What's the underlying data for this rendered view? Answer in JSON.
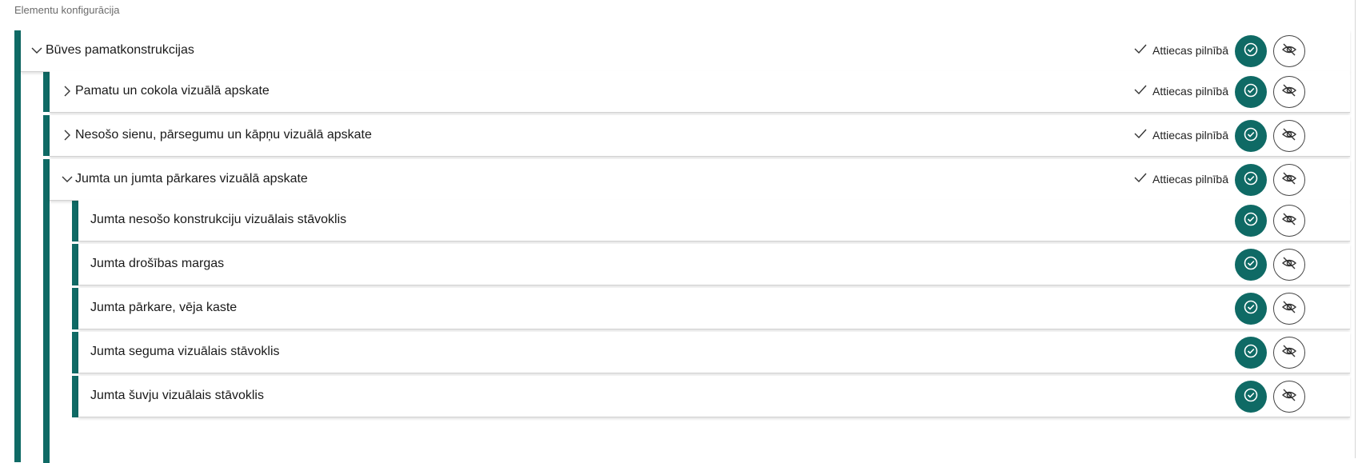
{
  "section_title": "Elementu konfigurācija",
  "status_label": "Attiecas pilnībā",
  "colors": {
    "accent": "#0f6a65",
    "border": "#d2d2d2"
  },
  "icons": {
    "confirm": "check-circle-icon",
    "hide": "eye-off-icon",
    "expanded": "chevron-down-icon",
    "collapsed": "chevron-right-icon",
    "status": "check-icon"
  },
  "tree": {
    "root": {
      "label": "Būves pamatkonstrukcijas",
      "expanded": true,
      "status": "Attiecas pilnībā"
    },
    "children": [
      {
        "label": "Pamatu un cokola vizuālā apskate",
        "expanded": false,
        "status": "Attiecas pilnībā"
      },
      {
        "label": "Nesošo sienu, pārsegumu un kāpņu vizuālā apskate",
        "expanded": false,
        "status": "Attiecas pilnībā"
      },
      {
        "label": "Jumta un jumta pārkares vizuālā apskate",
        "expanded": true,
        "status": "Attiecas pilnībā",
        "children": [
          {
            "label": "Jumta nesošo konstrukciju vizuālais stāvoklis"
          },
          {
            "label": "Jumta drošības margas"
          },
          {
            "label": "Jumta pārkare, vēja kaste"
          },
          {
            "label": "Jumta seguma vizuālais stāvoklis"
          },
          {
            "label": "Jumta šuvju vizuālais stāvoklis"
          }
        ]
      }
    ]
  }
}
